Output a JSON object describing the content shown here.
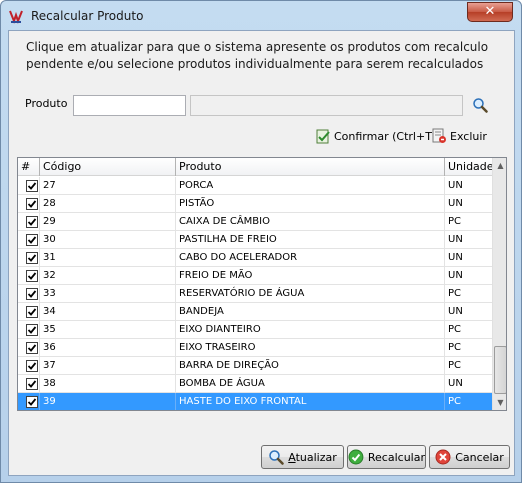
{
  "window": {
    "title": "Recalcular Produto",
    "close_glyph": "✕"
  },
  "instructions": "Clique em atualizar para que o sistema apresente os produtos com recalculo pendente e/ou selecione produtos individualmente para serem recalculados",
  "produto": {
    "label": "Produto",
    "code_value": "",
    "description_value": ""
  },
  "toolbar": {
    "confirm_label": "Confirmar (Ctrl+T)",
    "excluir_label": "Excluir"
  },
  "grid": {
    "columns": [
      "#",
      "Código",
      "Produto",
      "Unidade"
    ],
    "rows": [
      {
        "checked": true,
        "codigo": "27",
        "produto": "PORCA",
        "unidade": "UN"
      },
      {
        "checked": true,
        "codigo": "28",
        "produto": "PISTÃO",
        "unidade": "UN"
      },
      {
        "checked": true,
        "codigo": "29",
        "produto": "CAIXA DE CÂMBIO",
        "unidade": "PC"
      },
      {
        "checked": true,
        "codigo": "30",
        "produto": "PASTILHA DE FREIO",
        "unidade": "UN"
      },
      {
        "checked": true,
        "codigo": "31",
        "produto": "CABO DO ACELERADOR",
        "unidade": "UN"
      },
      {
        "checked": true,
        "codigo": "32",
        "produto": "FREIO DE MÃO",
        "unidade": "UN"
      },
      {
        "checked": true,
        "codigo": "33",
        "produto": "RESERVATÓRIO DE ÁGUA",
        "unidade": "PC"
      },
      {
        "checked": true,
        "codigo": "34",
        "produto": "BANDEJA",
        "unidade": "UN"
      },
      {
        "checked": true,
        "codigo": "35",
        "produto": "EIXO DIANTEIRO",
        "unidade": "PC"
      },
      {
        "checked": true,
        "codigo": "36",
        "produto": "EIXO TRASEIRO",
        "unidade": "PC"
      },
      {
        "checked": true,
        "codigo": "37",
        "produto": "BARRA DE DIREÇÃO",
        "unidade": "PC"
      },
      {
        "checked": true,
        "codigo": "38",
        "produto": "BOMBA DE ÁGUA",
        "unidade": "UN"
      },
      {
        "checked": true,
        "codigo": "39",
        "produto": "HASTE DO EIXO FRONTAL",
        "unidade": "PC",
        "selected": true
      }
    ]
  },
  "buttons": {
    "atualizar": "Atualizar",
    "recalcular": "Recalcular",
    "cancelar": "Cancelar"
  },
  "icons": {
    "app": "app-logo-icon",
    "search": "magnifier-icon",
    "confirm": "confirm-document-icon",
    "excluir": "delete-document-icon",
    "atualizar": "magnifier-icon",
    "recalcular": "green-check-icon",
    "cancelar": "red-cancel-icon"
  },
  "colors": {
    "selection": "#3399ff",
    "close_button": "#c85a45"
  }
}
